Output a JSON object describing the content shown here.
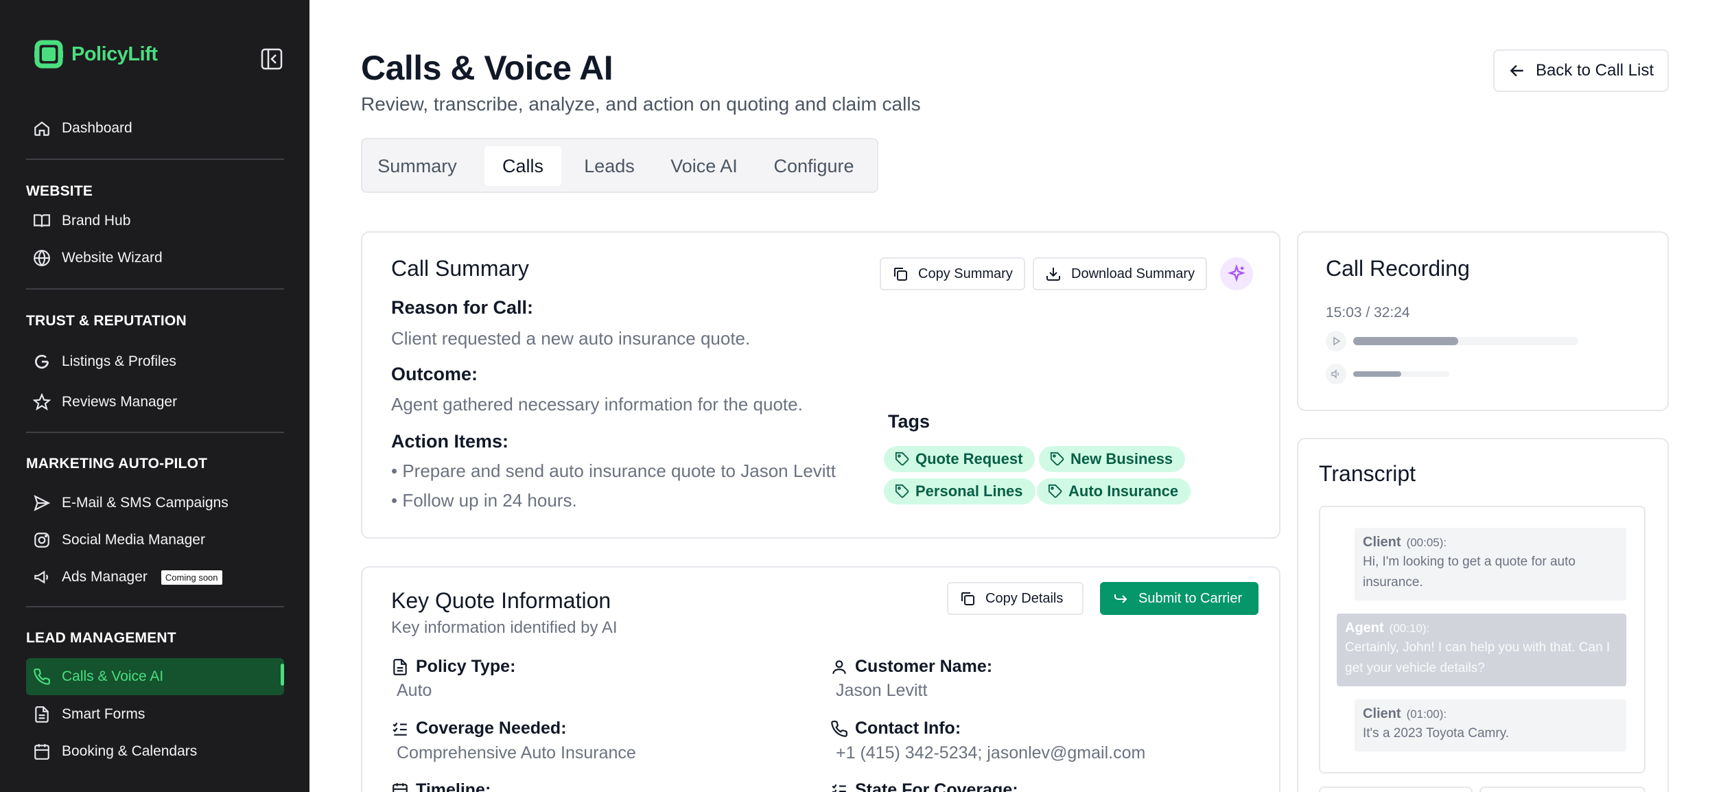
{
  "app": {
    "name": "PolicyLift",
    "brand_color": "#4ade80"
  },
  "sidebar": {
    "dashboard": "Dashboard",
    "sections": {
      "website": "WEBSITE",
      "trust": "TRUST & REPUTATION",
      "marketing": "MARKETING AUTO-PILOT",
      "lead": "LEAD MANAGEMENT"
    },
    "items": {
      "brand_hub": "Brand Hub",
      "website_wizard": "Website Wizard",
      "listings": "Listings & Profiles",
      "reviews": "Reviews Manager",
      "campaigns": "E-Mail & SMS Campaigns",
      "social": "Social Media Manager",
      "ads": "Ads Manager",
      "ads_badge": "Coming soon",
      "calls": "Calls & Voice AI",
      "forms": "Smart Forms",
      "booking": "Booking & Calendars"
    },
    "active_item": "calls"
  },
  "header": {
    "title": "Calls & Voice AI",
    "subtitle": "Review, transcribe, analyze, and action on quoting and claim calls",
    "back_label": "Back to Call List"
  },
  "tabs": [
    {
      "label": "Summary",
      "active": false
    },
    {
      "label": "Calls",
      "active": true
    },
    {
      "label": "Leads",
      "active": false
    },
    {
      "label": "Voice AI",
      "active": false
    },
    {
      "label": "Configure",
      "active": false
    }
  ],
  "call_summary": {
    "title": "Call Summary",
    "copy_label": "Copy Summary",
    "download_label": "Download Summary",
    "reason_label": "Reason for Call:",
    "reason": "Client requested a new auto insurance quote.",
    "outcome_label": "Outcome:",
    "outcome": "Agent gathered necessary information for the quote.",
    "actions_label": "Action Items:",
    "actions": [
      "• Prepare and send auto insurance quote to Jason Levitt",
      "• Follow up in 24 hours."
    ],
    "tags_label": "Tags",
    "tags": [
      "Quote Request",
      "New Business",
      "Personal Lines",
      "Auto Insurance"
    ]
  },
  "recording": {
    "title": "Call Recording",
    "time": "15:03 / 32:24",
    "progress": 0.465,
    "volume": 0.5
  },
  "transcript": {
    "title": "Transcript",
    "messages": [
      {
        "speaker": "Client",
        "time": "(00:05):",
        "text": "Hi, I'm looking to get a quote for auto insurance."
      },
      {
        "speaker": "Agent",
        "time": "(00:10):",
        "text": "Certainly, John! I can help you with that. Can I get your vehicle details?"
      },
      {
        "speaker": "Client",
        "time": "(01:00):",
        "text": "It's a 2023 Toyota Camry."
      }
    ]
  },
  "quote_info": {
    "title": "Key Quote Information",
    "subtitle": "Key information identified by AI",
    "copy_label": "Copy Details",
    "submit_label": "Submit to Carrier",
    "policy_type_label": "Policy Type:",
    "policy_type": "Auto",
    "customer_label": "Customer Name:",
    "customer": "Jason Levitt",
    "coverage_label": "Coverage Needed:",
    "coverage": "Comprehensive Auto Insurance",
    "contact_label": "Contact Info:",
    "contact": "+1 (415) 342-5234; jasonlev@gmail.com",
    "timeline_label": "Timeline:",
    "state_label": "State For Coverage:"
  }
}
